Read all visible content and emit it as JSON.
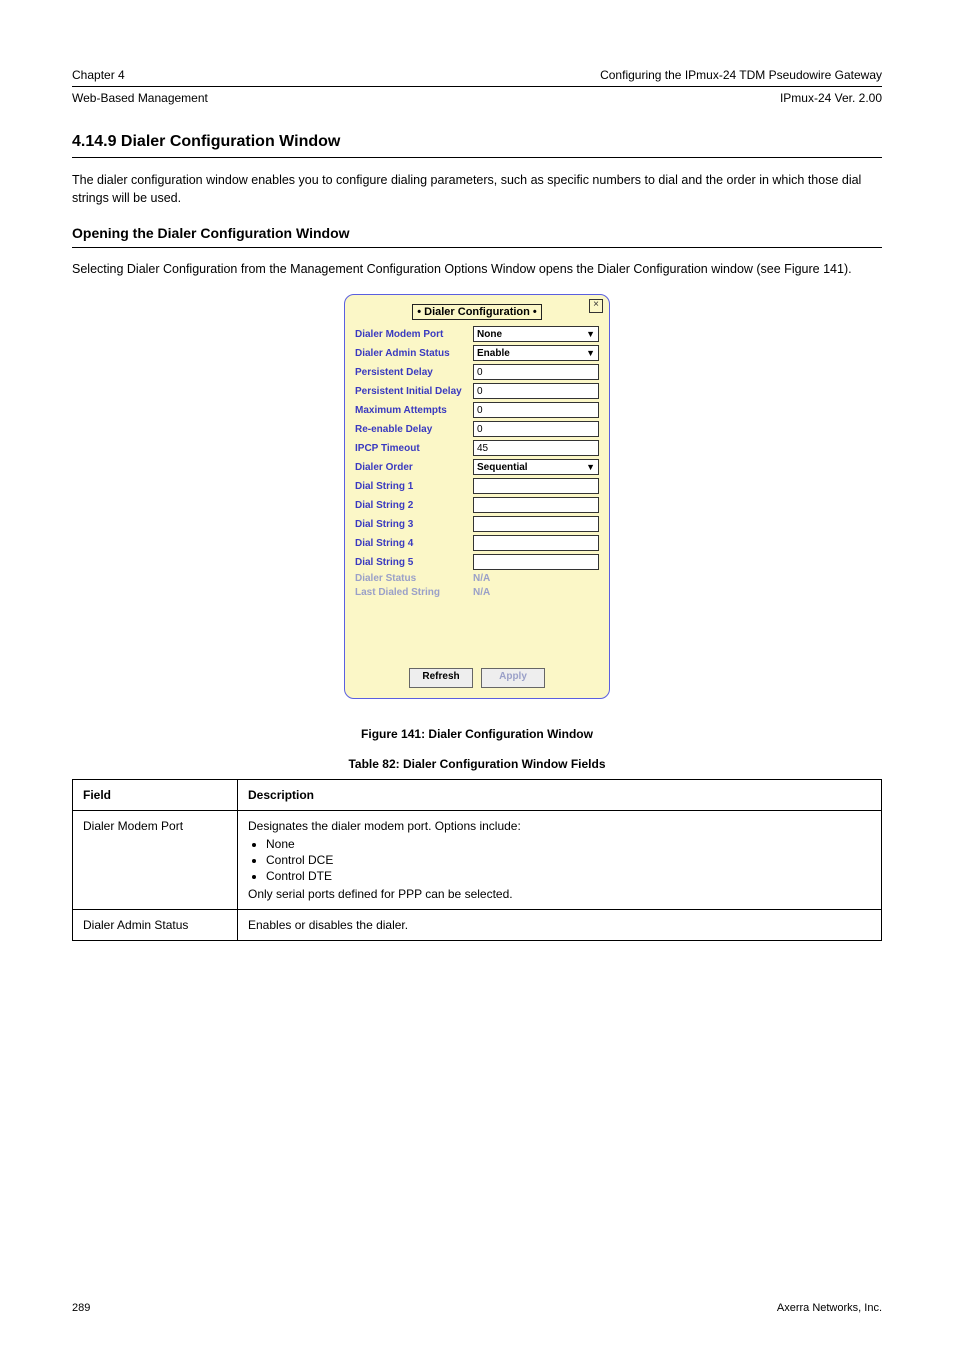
{
  "header": {
    "left_small": "Chapter 4",
    "right_small": "Configuring the IPmux-24 TDM Pseudowire Gateway",
    "line2_left": "Web-Based Management",
    "line2_right": "IPmux-24 Ver. 2.00"
  },
  "section": {
    "number_and_title": "4.14.9  Dialer Configuration Window",
    "intro_paragraph": "The dialer configuration window enables you to configure dialing parameters, such as specific numbers to dial and the order in which those dial strings will be used.",
    "open_heading": "Opening the Dialer Configuration Window",
    "open_paragraph": "Selecting Dialer Configuration from the Management Configuration Options Window opens the Dialer Configuration window (see Figure 141)."
  },
  "dialog": {
    "title": "• Dialer Configuration •",
    "close_x": "×",
    "rows": {
      "modem_port": {
        "label": "Dialer Modem Port",
        "value": "None",
        "type": "select"
      },
      "admin_status": {
        "label": "Dialer Admin Status",
        "value": "Enable",
        "type": "select"
      },
      "persistent_delay": {
        "label": "Persistent Delay",
        "value": "0",
        "type": "text"
      },
      "initial_delay": {
        "label": "Persistent Initial Delay",
        "value": "0",
        "type": "text"
      },
      "max_attempts": {
        "label": "Maximum Attempts",
        "value": "0",
        "type": "text"
      },
      "reenable_delay": {
        "label": "Re-enable Delay",
        "value": "0",
        "type": "text"
      },
      "ipcp_timeout": {
        "label": "IPCP Timeout",
        "value": "45",
        "type": "text"
      },
      "dialer_order": {
        "label": "Dialer Order",
        "value": "Sequential",
        "type": "select"
      },
      "dial1": {
        "label": "Dial String 1",
        "value": "",
        "type": "text"
      },
      "dial2": {
        "label": "Dial String 2",
        "value": "",
        "type": "text"
      },
      "dial3": {
        "label": "Dial String 3",
        "value": "",
        "type": "text"
      },
      "dial4": {
        "label": "Dial String 4",
        "value": "",
        "type": "text"
      },
      "dial5": {
        "label": "Dial String 5",
        "value": "",
        "type": "text"
      },
      "dialer_status": {
        "label": "Dialer Status",
        "value": "N/A",
        "type": "static"
      },
      "last_dialed": {
        "label": "Last Dialed String",
        "value": "N/A",
        "type": "static"
      }
    },
    "buttons": {
      "refresh": "Refresh",
      "apply": "Apply"
    }
  },
  "figure_caption": "Figure 141: Dialer Configuration Window",
  "table_caption": "Table 82: Dialer Configuration Window Fields",
  "table": {
    "headers": {
      "field": "Field",
      "desc": "Description"
    },
    "row1": {
      "field": "Dialer Modem Port",
      "desc_intro": "Designates the dialer modem port. Options include:",
      "opts": [
        "None",
        "Control DCE",
        "Control DTE"
      ],
      "desc_note": "Only serial ports defined for PPP can be selected."
    },
    "row2": {
      "field": "Dialer Admin Status",
      "desc": "Enables or disables the dialer."
    }
  },
  "footer": {
    "left": "289",
    "right": "Axerra Networks, Inc."
  }
}
